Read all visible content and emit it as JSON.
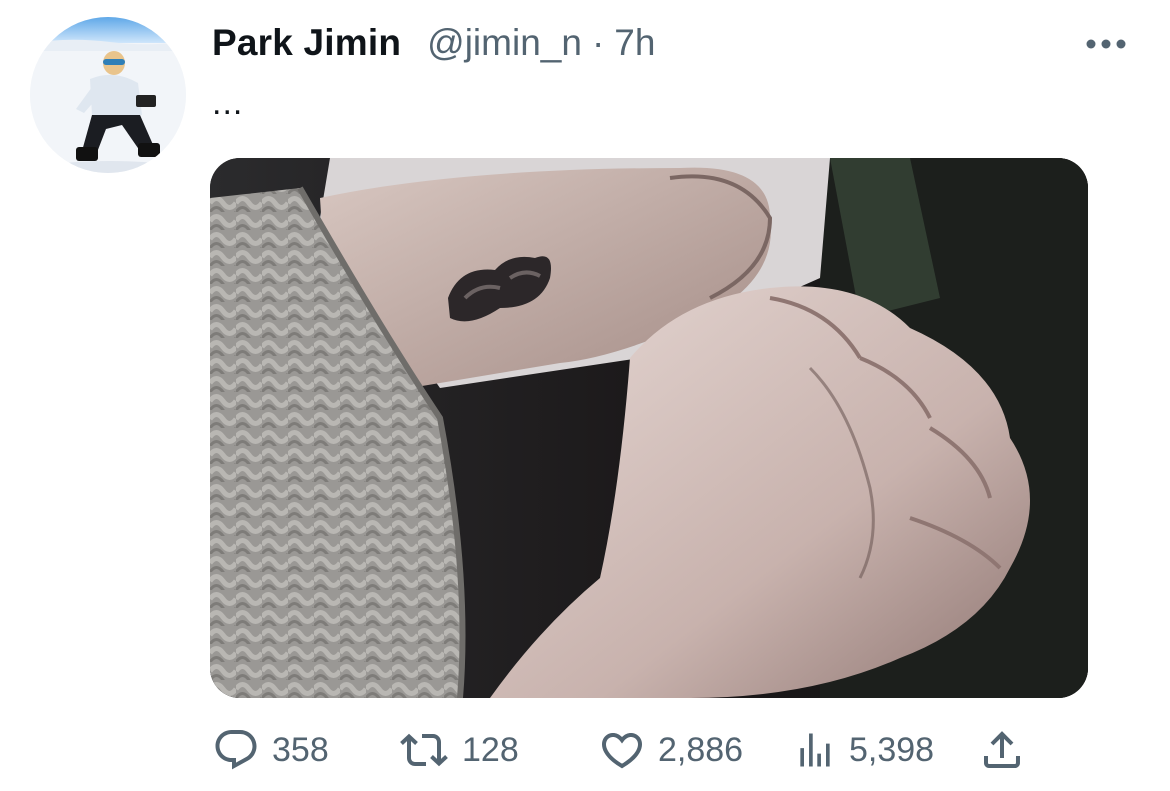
{
  "tweet": {
    "author": {
      "display_name": "Park Jimin",
      "handle": "@jimin_n",
      "avatar_icon": "profile-photo-snowboarder"
    },
    "separator": "·",
    "time": "7h",
    "text": "...",
    "media_description_icon": "photo-hands-tattoo",
    "stats": {
      "replies": "358",
      "retweets": "128",
      "likes": "2,886",
      "views": "5,398"
    }
  },
  "icons": {
    "more": "more-horizontal-icon",
    "reply": "reply-icon",
    "retweet": "retweet-icon",
    "like": "heart-icon",
    "views": "views-icon",
    "share": "share-icon"
  },
  "colors": {
    "text_primary": "#0f1419",
    "text_secondary": "#536471",
    "background": "#ffffff"
  }
}
